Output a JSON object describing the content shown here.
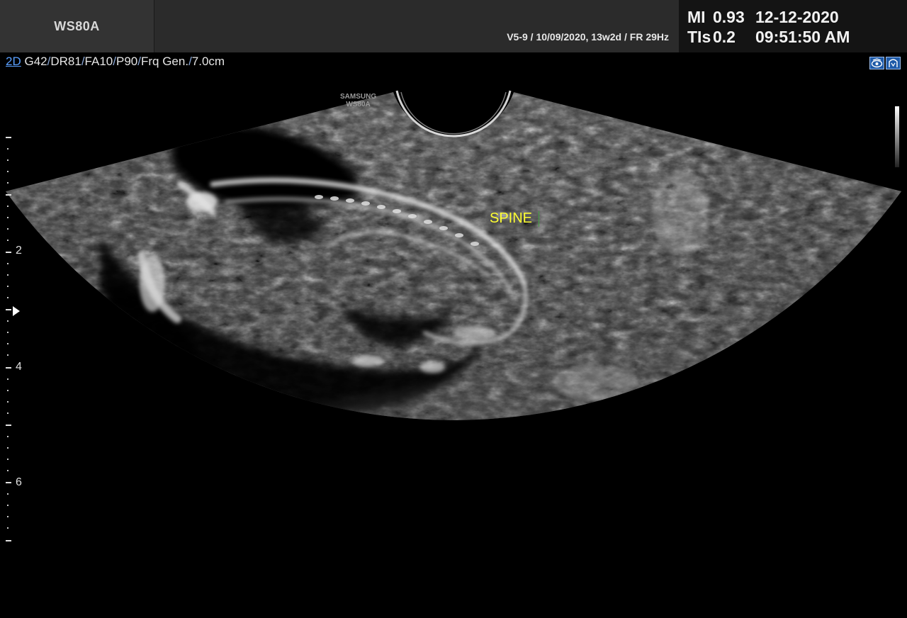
{
  "header": {
    "model": "WS80A",
    "exam_info": "V5-9 / 10/09/2020, 13w2d / FR 29Hz",
    "mi_label": "MI",
    "mi_value": "0.93",
    "tis_label": "TIs",
    "tis_value": "0.2",
    "date": "12-12-2020",
    "time": "09:51:50 AM"
  },
  "params": {
    "mode": "2D",
    "gain": "G42",
    "dynamic_range": "DR81",
    "frame_avg": "FA10",
    "power": "P90",
    "frequency": "Frq Gen.",
    "depth": "7.0cm"
  },
  "toolbar": {
    "icons": [
      "probe-view-icon",
      "fetal-face-icon"
    ]
  },
  "image": {
    "vendor_mark_1": "SAMSUNG",
    "vendor_mark_2": "WS80A",
    "annotation": "SPINE"
  },
  "depth_scale": {
    "labels": [
      "2",
      "4",
      "6"
    ]
  },
  "colors": {
    "annotation": "#ffff33",
    "mode_accent": "#5aa0ff",
    "header_bg": "#2a2a2a"
  }
}
